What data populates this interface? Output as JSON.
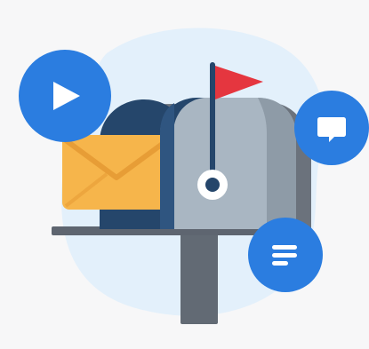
{
  "illustration": {
    "subject": "mailbox",
    "colors": {
      "background": "#f7f7f8",
      "blob": "#e3f0fb",
      "accent_blue": "#2b7de0",
      "mailbox_body": "#a9b6c2",
      "mailbox_dark": "#5e6570",
      "mailbox_edge": "#25466b",
      "envelope": "#f6b54b",
      "envelope_dark": "#e79d36",
      "flag": "#e5363f",
      "post": "#626a74"
    },
    "icons": [
      "play-icon",
      "chat-icon",
      "text-lines-icon",
      "flag-icon",
      "envelope-icon"
    ]
  }
}
